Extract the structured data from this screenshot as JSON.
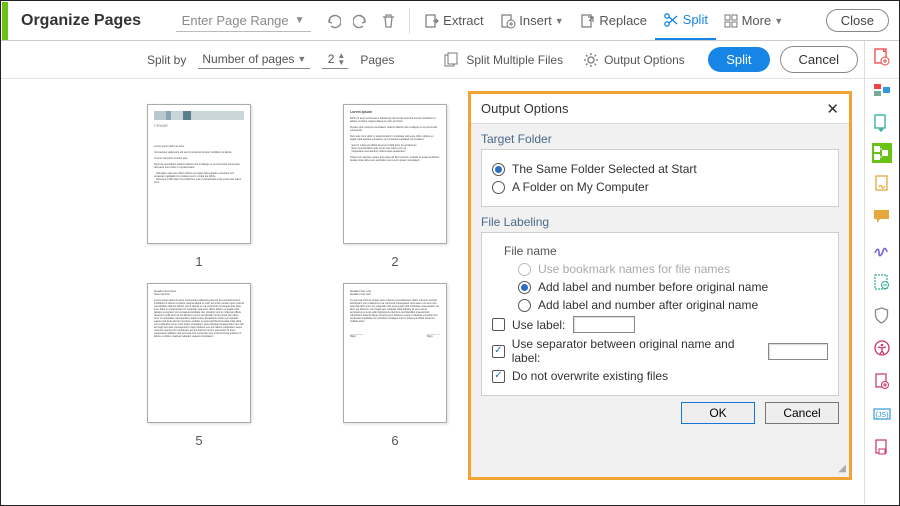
{
  "top": {
    "title": "Organize Pages",
    "range_placeholder": "Enter Page Range",
    "extract": "Extract",
    "insert": "Insert",
    "replace": "Replace",
    "split": "Split",
    "more": "More",
    "close": "Close"
  },
  "sub": {
    "splitby": "Split by",
    "mode": "Number of pages",
    "count": "2",
    "pages": "Pages",
    "multi": "Split Multiple Files",
    "opts": "Output Options",
    "go": "Split",
    "cancel": "Cancel"
  },
  "thumbs": [
    "1",
    "2",
    "5",
    "6"
  ],
  "dialog": {
    "title": "Output Options",
    "targetFolder": "Target Folder",
    "tf_same": "The Same Folder Selected at Start",
    "tf_other": "A Folder on My Computer",
    "fileLabeling": "File Labeling",
    "fileName": "File name",
    "fn_bm": "Use bookmark names for file names",
    "fn_before": "Add label and number before original name",
    "fn_after": "Add label and number after original name",
    "useLabel": "Use label:",
    "useSep": "Use separator between original name and label:",
    "noOverwrite": "Do not overwrite existing files",
    "ok": "OK",
    "cancel": "Cancel"
  }
}
